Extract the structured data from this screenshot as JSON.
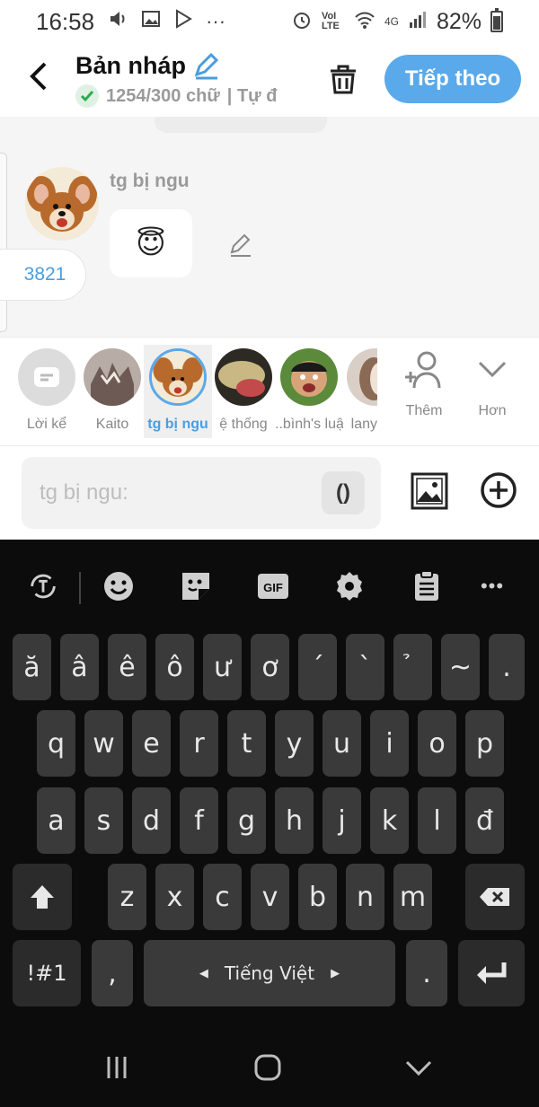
{
  "status_bar": {
    "time": "16:58",
    "network": "VoI LTE",
    "network_type": "4G",
    "battery": "82%"
  },
  "header": {
    "title": "Bản nháp",
    "word_count": "1254/300 chữ",
    "autosave": "| Tự đ",
    "next_label": "Tiếp theo"
  },
  "chat": {
    "speaker_name": "tg bị ngu",
    "message_emoji": "😇",
    "count_pill": "3821"
  },
  "characters": [
    {
      "name": "Lời kể",
      "selected": false
    },
    {
      "name": "Kaito",
      "selected": false
    },
    {
      "name": "tg bị ngu",
      "selected": true
    },
    {
      "name": "ệ thống",
      "selected": false
    },
    {
      "name": "..bình's luận",
      "selected": false
    },
    {
      "name": "lany",
      "selected": false
    }
  ],
  "strip_actions": {
    "add_label": "Thêm",
    "more_label": "Hơn"
  },
  "input": {
    "placeholder": "tg bị ngu:",
    "paren_label": "()"
  },
  "keyboard": {
    "row_vn": [
      "ă",
      "â",
      "ê",
      "ô",
      "ư",
      "ơ",
      "´",
      "`",
      "̉",
      "~",
      "."
    ],
    "row1": [
      "q",
      "w",
      "e",
      "r",
      "t",
      "y",
      "u",
      "i",
      "o",
      "p"
    ],
    "row2": [
      "a",
      "s",
      "d",
      "f",
      "g",
      "h",
      "j",
      "k",
      "l",
      "đ"
    ],
    "row3": [
      "z",
      "x",
      "c",
      "v",
      "b",
      "n",
      "m"
    ],
    "symbols_label": "!#1",
    "comma": ",",
    "space_label": "Tiếng Việt",
    "period": "."
  },
  "colors": {
    "accent": "#5aa9ea",
    "keyboard_bg": "#0c0c0c",
    "key_bg": "#3a3a3a"
  }
}
